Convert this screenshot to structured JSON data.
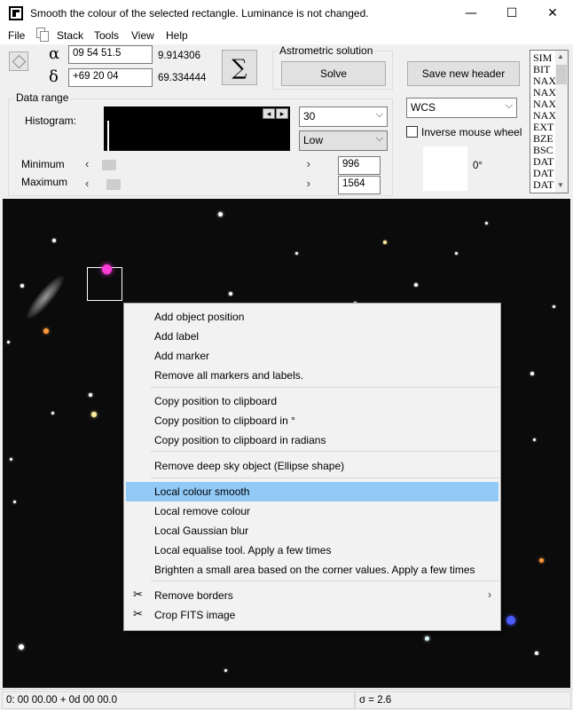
{
  "window": {
    "title": "Smooth the colour of the selected rectangle. Luminance is not changed.",
    "controls": [
      "—",
      "☐",
      "✕"
    ]
  },
  "menu": [
    "File",
    "Stack",
    "Tools",
    "View",
    "Help"
  ],
  "position": {
    "alpha_symbol": "α",
    "delta_symbol": "δ",
    "ra": "09 54 51.5",
    "dec": "+69 20 04",
    "ra_deg": "9.914306",
    "dec_deg": "69.334444",
    "sigma": "∑"
  },
  "astrometric": {
    "title": "Astrometric solution",
    "solve": "Solve",
    "save_header": "Save new header"
  },
  "header_list": [
    "SIM",
    "BIT",
    "NAX",
    "NAX",
    "NAX",
    "NAX",
    "EXT",
    "BZE",
    "BSC",
    "DAT",
    "DAT",
    "DAT"
  ],
  "data_range": {
    "title": "Data range",
    "histogram_label": "Histogram:",
    "bins": "30",
    "mode": "Low",
    "minimum_label": "Minimum",
    "maximum_label": "Maximum",
    "minimum_value": "996",
    "maximum_value": "1564",
    "minimum_level": 0.03,
    "maximum_level": 0.05
  },
  "projection": "WCS",
  "inverse_wheel": "Inverse mouse wheel",
  "rotation": "0°",
  "context_menu": {
    "items": [
      {
        "label": "Add object position"
      },
      {
        "label": "Add label"
      },
      {
        "label": "Add marker"
      },
      {
        "label": "Remove all markers and labels."
      },
      {
        "label": "Copy position to clipboard"
      },
      {
        "label": "Copy position to clipboard in °"
      },
      {
        "label": "Copy position to clipboard in radians"
      },
      {
        "label": "Remove deep sky object (Ellipse shape)"
      },
      {
        "label": "Local colour smooth",
        "highlighted": true
      },
      {
        "label": "Local remove colour"
      },
      {
        "label": "Local Gaussian blur"
      },
      {
        "label": "Local equalise tool. Apply a few times"
      },
      {
        "label": "Brighten a small area based on the corner values. Apply a few times"
      },
      {
        "label": "Remove borders",
        "submenu": "›",
        "icon": "scissors-icon"
      },
      {
        "label": "Crop FITS image",
        "icon": "crop-scissors-icon"
      }
    ],
    "icon_glyph": "✂"
  },
  "status": {
    "coords": "0: 00  00.00   + 0d 00  00.0",
    "sigma": "σ = 2.6"
  },
  "colors": {
    "highlight": "#91c9f7",
    "image_bg": "#0b0b0b",
    "selected_star": "#ff3cd8"
  }
}
